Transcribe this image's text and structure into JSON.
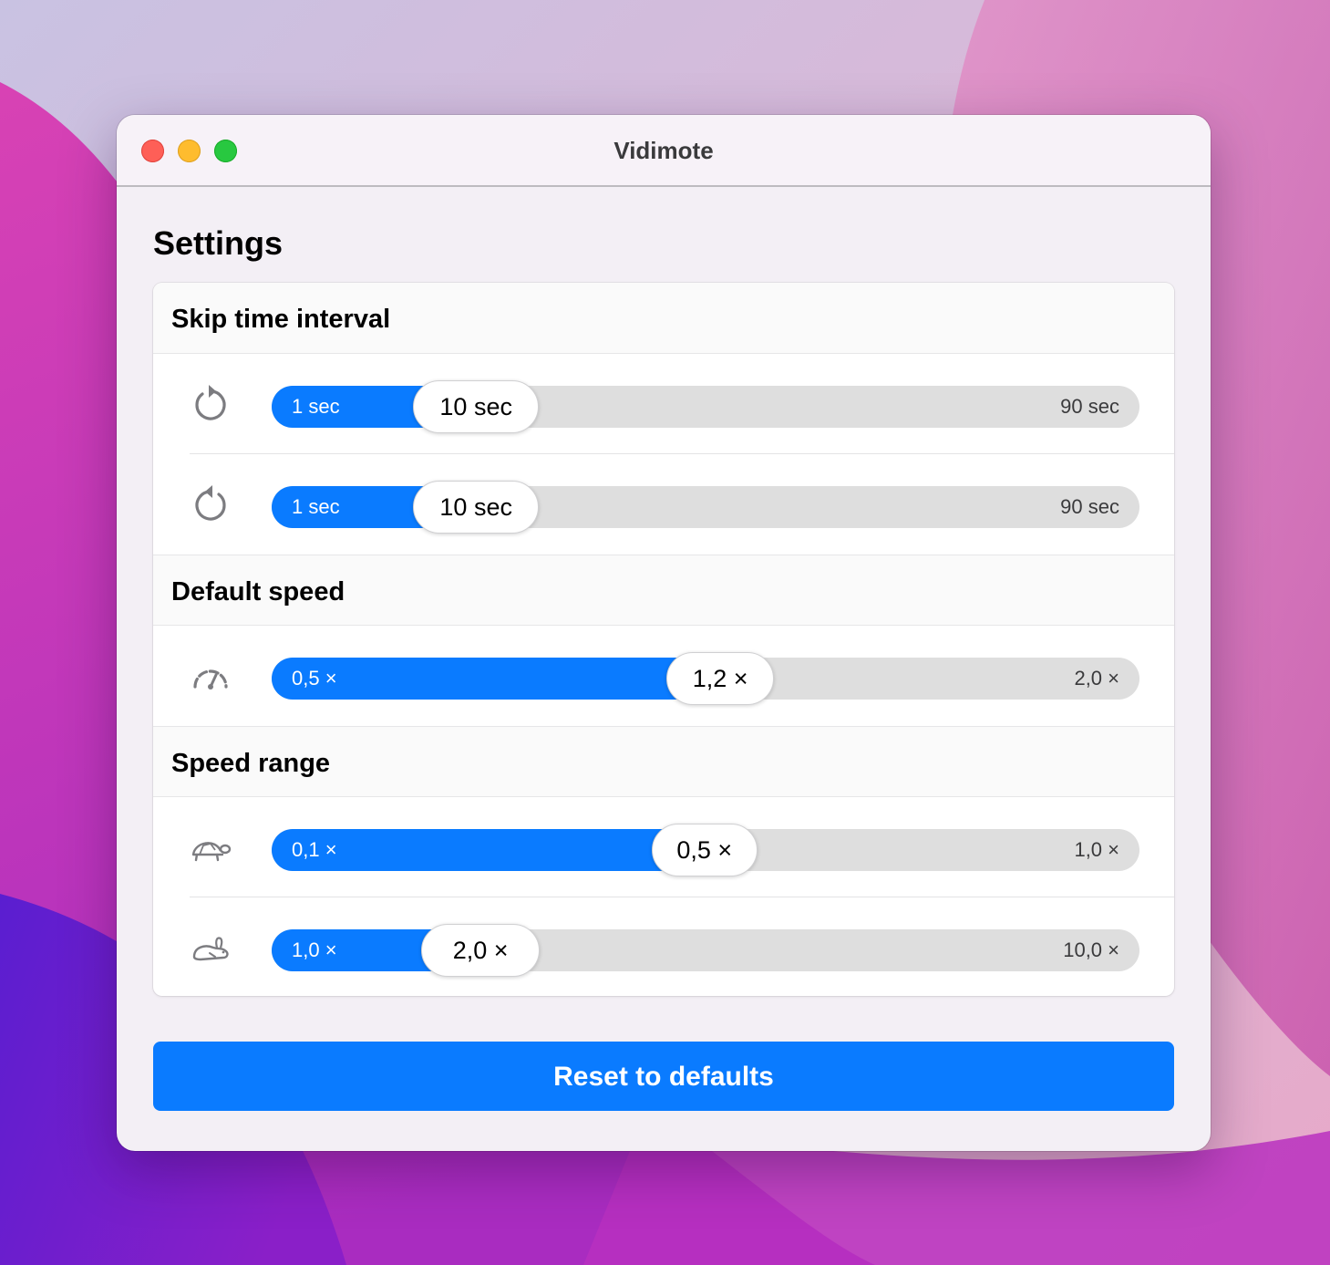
{
  "window": {
    "title": "Vidimote"
  },
  "page": {
    "title": "Settings"
  },
  "sections": {
    "skip": {
      "title": "Skip time interval",
      "backward": {
        "icon": "rotate-backward-icon",
        "min": "1 sec",
        "max": "90 sec",
        "value": "10 sec",
        "fraction": 0.1
      },
      "forward": {
        "icon": "rotate-forward-icon",
        "min": "1 sec",
        "max": "90 sec",
        "value": "10 sec",
        "fraction": 0.1
      }
    },
    "speed": {
      "title": "Default speed",
      "default": {
        "icon": "speedometer-icon",
        "min": "0,5 ×",
        "max": "2,0 ×",
        "value": "1,2 ×",
        "fraction": 0.467
      }
    },
    "range": {
      "title": "Speed range",
      "slow": {
        "icon": "tortoise-icon",
        "min": "0,1 ×",
        "max": "1,0 ×",
        "value": "0,5 ×",
        "fraction": 0.444
      },
      "fast": {
        "icon": "hare-icon",
        "min": "1,0 ×",
        "max": "10,0 ×",
        "value": "2,0 ×",
        "fraction": 0.111
      }
    }
  },
  "actions": {
    "reset_label": "Reset to defaults"
  },
  "colors": {
    "accent": "#0a7bff",
    "track": "#dedede",
    "close": "#fe5f57",
    "minimize": "#febc2e",
    "zoom": "#28c840"
  }
}
